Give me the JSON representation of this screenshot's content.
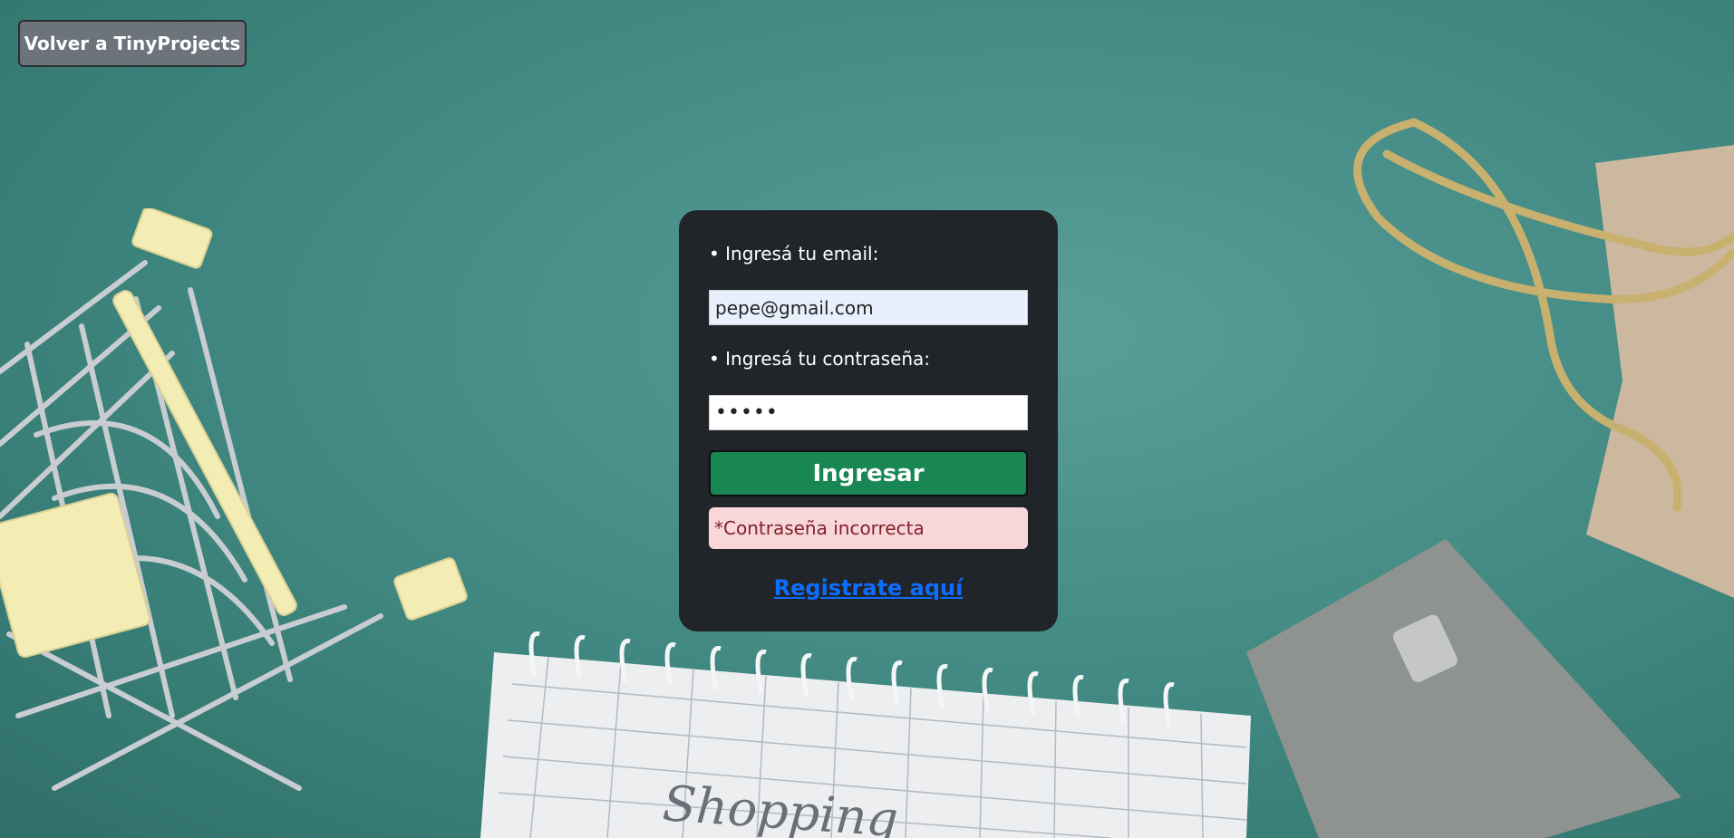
{
  "header": {
    "back_button_label": "Volver a TinyProjects"
  },
  "login_form": {
    "email_label": "• Ingresá tu email:",
    "email_value": "pepe@gmail.com",
    "password_label": "• Ingresá tu contraseña:",
    "password_value": "•••••",
    "submit_label": "Ingresar",
    "error_message": "*Contraseña incorrecta",
    "register_link_label": "Registrate aquí"
  },
  "background": {
    "notebook_text": "Shopping"
  },
  "colors": {
    "background": "#3f8780",
    "card": "#212429",
    "submit": "#198754",
    "error_bg": "#f8d7da",
    "error_text": "#842029",
    "link": "#0d6efd",
    "back_button": "#6c737b"
  }
}
